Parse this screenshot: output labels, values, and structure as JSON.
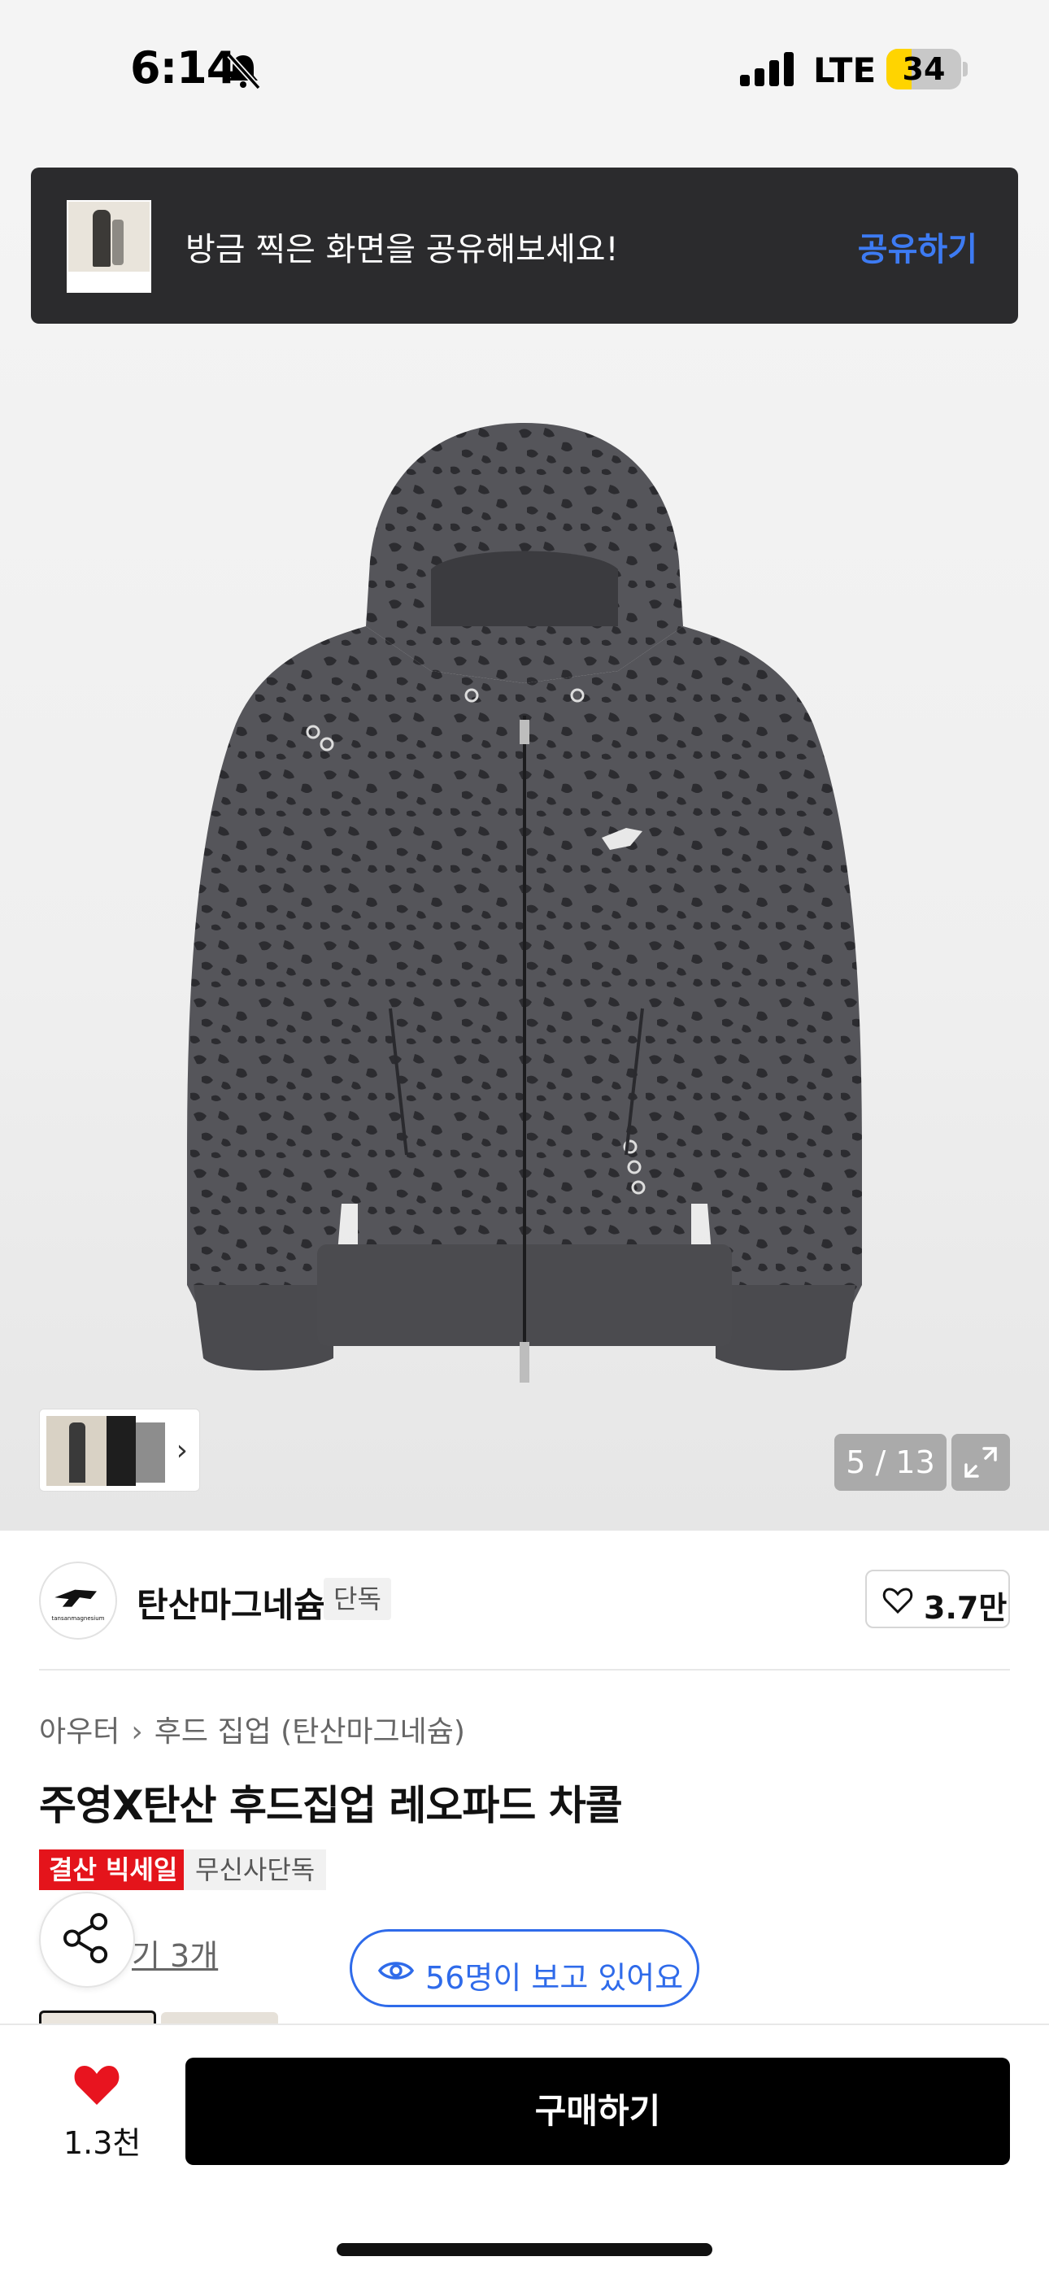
{
  "status_bar": {
    "time": "6:14",
    "network": "LTE",
    "battery": "34",
    "battery_level": 0.34
  },
  "toast": {
    "message": "방금 찍은 화면을 공유해보세요!",
    "action": "공유하기"
  },
  "gallery": {
    "counter": "5 / 13"
  },
  "brand": {
    "name": "탄산마그네슘",
    "tag": "단독",
    "logo_text": "tansanmagnesium",
    "likes": "3.7만"
  },
  "breadcrumb": {
    "category": "아우터",
    "subcategory": "후드 집업 (탄산마그네슘)"
  },
  "product": {
    "title": "주영X탄산 후드집업 레오파드 차콜",
    "badge_sale": "결산 빅세일",
    "badge_exclusive": "무신사단독",
    "review_link": "기 3개",
    "viewing": "56명이 보고 있어요"
  },
  "bottom_bar": {
    "like_count": "1.3천",
    "buy_label": "구매하기"
  },
  "colors": {
    "accent_blue": "#2f6bea",
    "sale_red": "#e4141b",
    "heart_red": "#e8141f",
    "battery_yellow": "#ffd400"
  },
  "icons": [
    "bell-slash-icon",
    "signal-icon",
    "battery-icon",
    "chevron-right-icon",
    "expand-icon",
    "heart-outline-icon",
    "share-icon",
    "eye-icon",
    "heart-filled-icon"
  ]
}
